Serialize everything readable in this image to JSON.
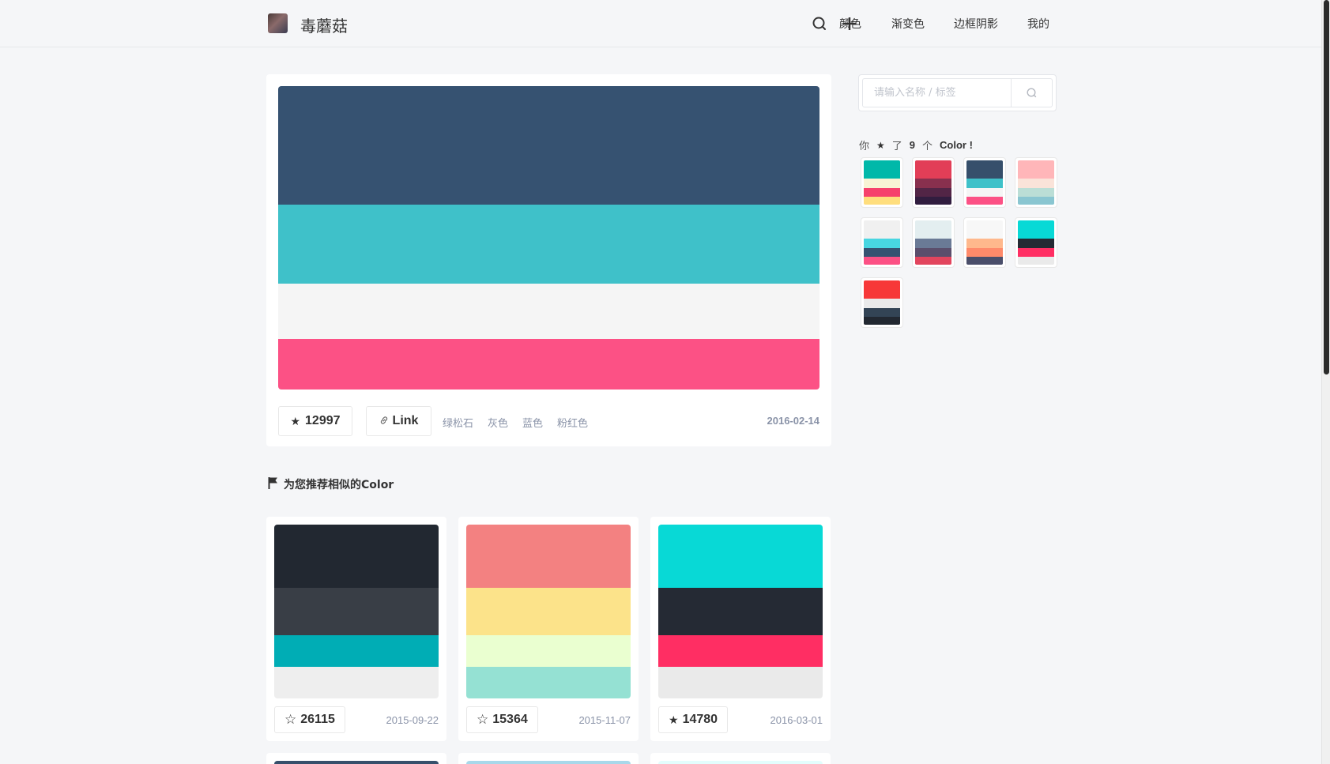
{
  "header": {
    "brand": "毒蘑菇",
    "nav": [
      "颜色",
      "渐变色",
      "边框阴影",
      "我的"
    ]
  },
  "main": {
    "palette": [
      "#365271",
      "#3fc1c9",
      "#f5f5f5",
      "#fc5185"
    ],
    "star_count": "12997",
    "link_label": "Link",
    "tags": [
      "绿松石",
      "灰色",
      "蓝色",
      "粉红色"
    ],
    "date": "2016-02-14"
  },
  "recommend": {
    "title": "为您推荐相似的Color",
    "cards": [
      {
        "palette": [
          "#222831",
          "#393e46",
          "#00adb5",
          "#eeeeee"
        ],
        "stars": "26115",
        "starred": false,
        "date": "2015-09-22"
      },
      {
        "palette": [
          "#f38181",
          "#fce38a",
          "#eaffd0",
          "#95e1d3"
        ],
        "stars": "15364",
        "starred": false,
        "date": "2015-11-07"
      },
      {
        "palette": [
          "#08d9d6",
          "#252a34",
          "#ff2e63",
          "#eaeaea"
        ],
        "stars": "14780",
        "starred": true,
        "date": "2016-03-01"
      }
    ],
    "peek_colors": [
      "#364f6b",
      "#a8d8ea",
      "#e3fdfd"
    ]
  },
  "sidebar": {
    "search_placeholder": "请输入名称 / 标签",
    "fav_prefix": "你",
    "fav_mid": "了",
    "fav_count": "9",
    "fav_suffix": "个",
    "fav_word": "Color !",
    "favorites": [
      [
        "#00b8a9",
        "#f8f3d4",
        "#f6416c",
        "#ffde7d"
      ],
      [
        "#e23e57",
        "#88304e",
        "#522546",
        "#311d3f"
      ],
      [
        "#364f6b",
        "#3fc1c9",
        "#f5f5f5",
        "#fc5185"
      ],
      [
        "#ffb6b9",
        "#fae3d9",
        "#bbded6",
        "#8ac6d1"
      ],
      [
        "#f0f0f0",
        "#48d6e1",
        "#365271",
        "#fc5185"
      ],
      [
        "#e3eef0",
        "#6a7a96",
        "#5b4e6c",
        "#e2455e"
      ],
      [
        "#f7f7f7",
        "#ffb88c",
        "#ff8a6a",
        "#4a4e6a"
      ],
      [
        "#08d9d6",
        "#252a34",
        "#ff2e63",
        "#eaeaea"
      ],
      [
        "#f73838",
        "#eaeaea",
        "#334455",
        "#222831"
      ]
    ]
  }
}
